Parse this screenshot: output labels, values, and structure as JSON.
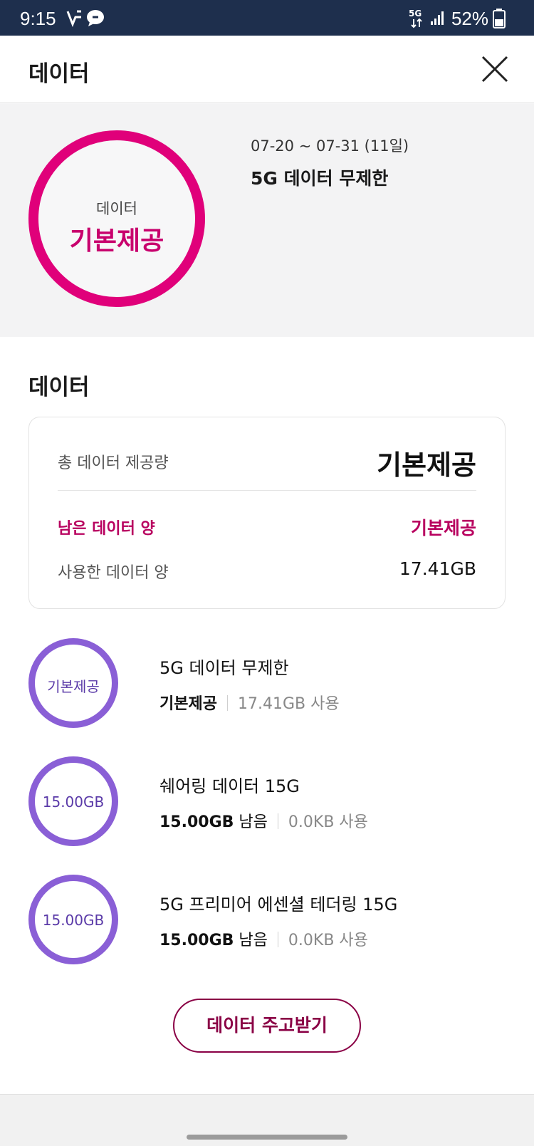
{
  "status_bar": {
    "time": "9:15",
    "network": "5G",
    "battery": "52%"
  },
  "header": {
    "title": "데이터"
  },
  "summary": {
    "ring_label": "데이터",
    "ring_value": "기본제공",
    "ring_color": "#e0007a",
    "period": "07-20 ~ 07-31 (11일)",
    "plan": "5G 데이터 무제한"
  },
  "section": {
    "title": "데이터"
  },
  "card": {
    "total_label": "총 데이터 제공량",
    "total_value": "기본제공",
    "remaining_label": "남은 데이터 양",
    "remaining_value": "기본제공",
    "used_label": "사용한 데이터 양",
    "used_value": "17.41GB"
  },
  "items": [
    {
      "ring_text": "기본제공",
      "name": "5G 데이터 무제한",
      "amount": "기본제공",
      "suffix": "",
      "used": "17.41GB 사용"
    },
    {
      "ring_text": "15.00GB",
      "name": "쉐어링 데이터 15G",
      "amount": "15.00GB",
      "suffix": " 남음",
      "used": "0.0KB 사용"
    },
    {
      "ring_text": "15.00GB",
      "name": "5G 프리미어 에센셜 테더링 15G",
      "amount": "15.00GB",
      "suffix": " 남음",
      "used": "0.0KB 사용"
    }
  ],
  "item_ring_color": "#8a5fd6",
  "gift_button": {
    "label": "데이터 주고받기"
  }
}
